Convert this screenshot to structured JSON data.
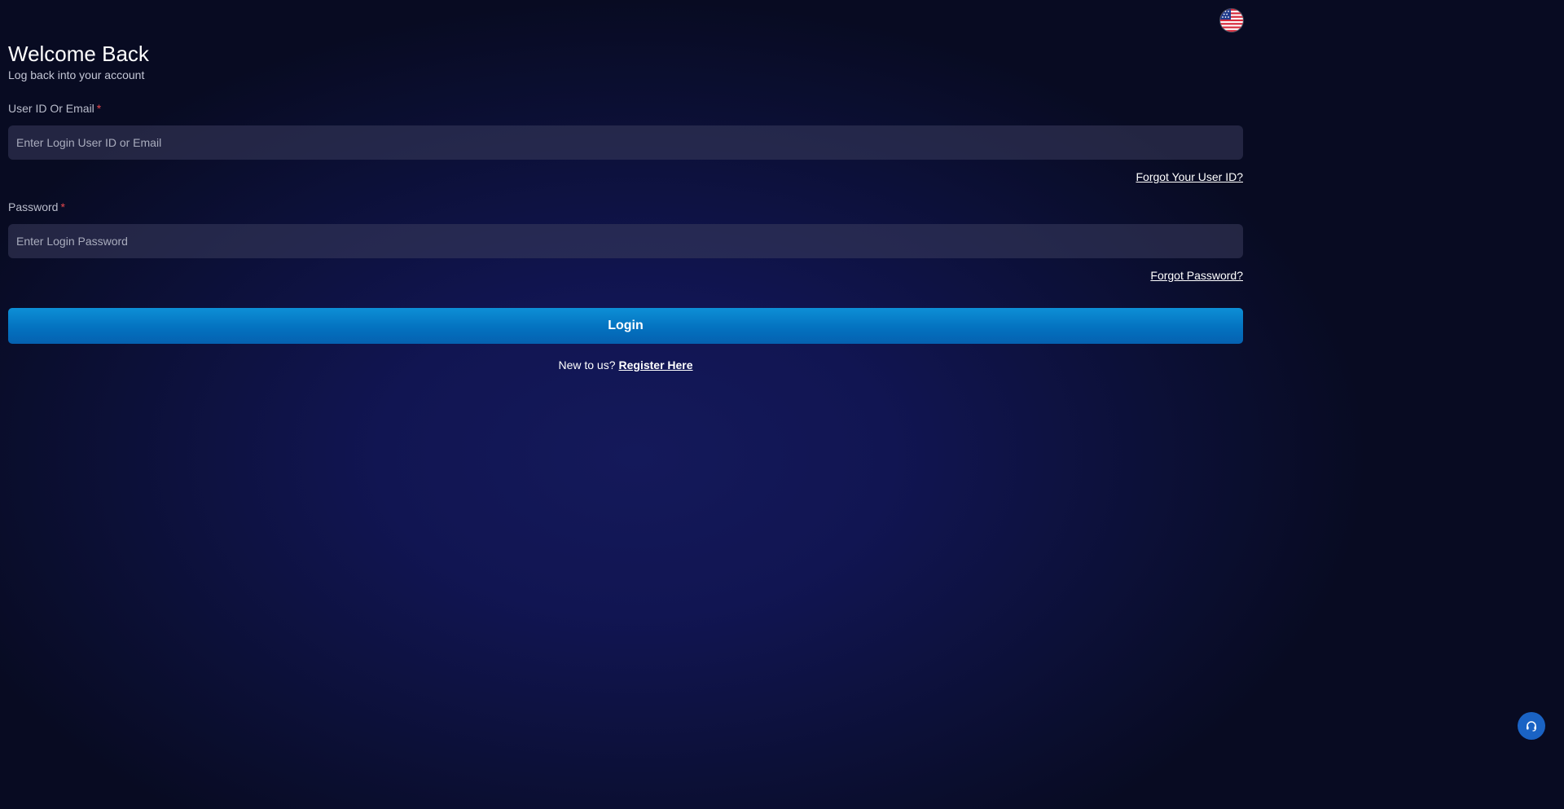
{
  "header": {
    "language": {
      "icon": "us-flag-icon",
      "alt": "English (US)"
    }
  },
  "login": {
    "title": "Welcome Back",
    "subtitle": "Log back into your account",
    "user_field": {
      "label": "User ID Or Email",
      "required_mark": "*",
      "placeholder": "Enter Login User ID or Email",
      "value": ""
    },
    "forgot_user_link": "Forgot Your User ID?",
    "password_field": {
      "label": "Password",
      "required_mark": "*",
      "placeholder": "Enter Login Password",
      "value": ""
    },
    "forgot_password_link": "Forgot Password?",
    "login_button": "Login",
    "register_prompt": "New to us?",
    "register_link": "Register Here"
  },
  "support": {
    "icon": "headset-icon"
  },
  "colors": {
    "accent": "#0a7fcc",
    "required": "#e5484d",
    "background": "#0c1038",
    "support_button": "#1a63c4"
  }
}
